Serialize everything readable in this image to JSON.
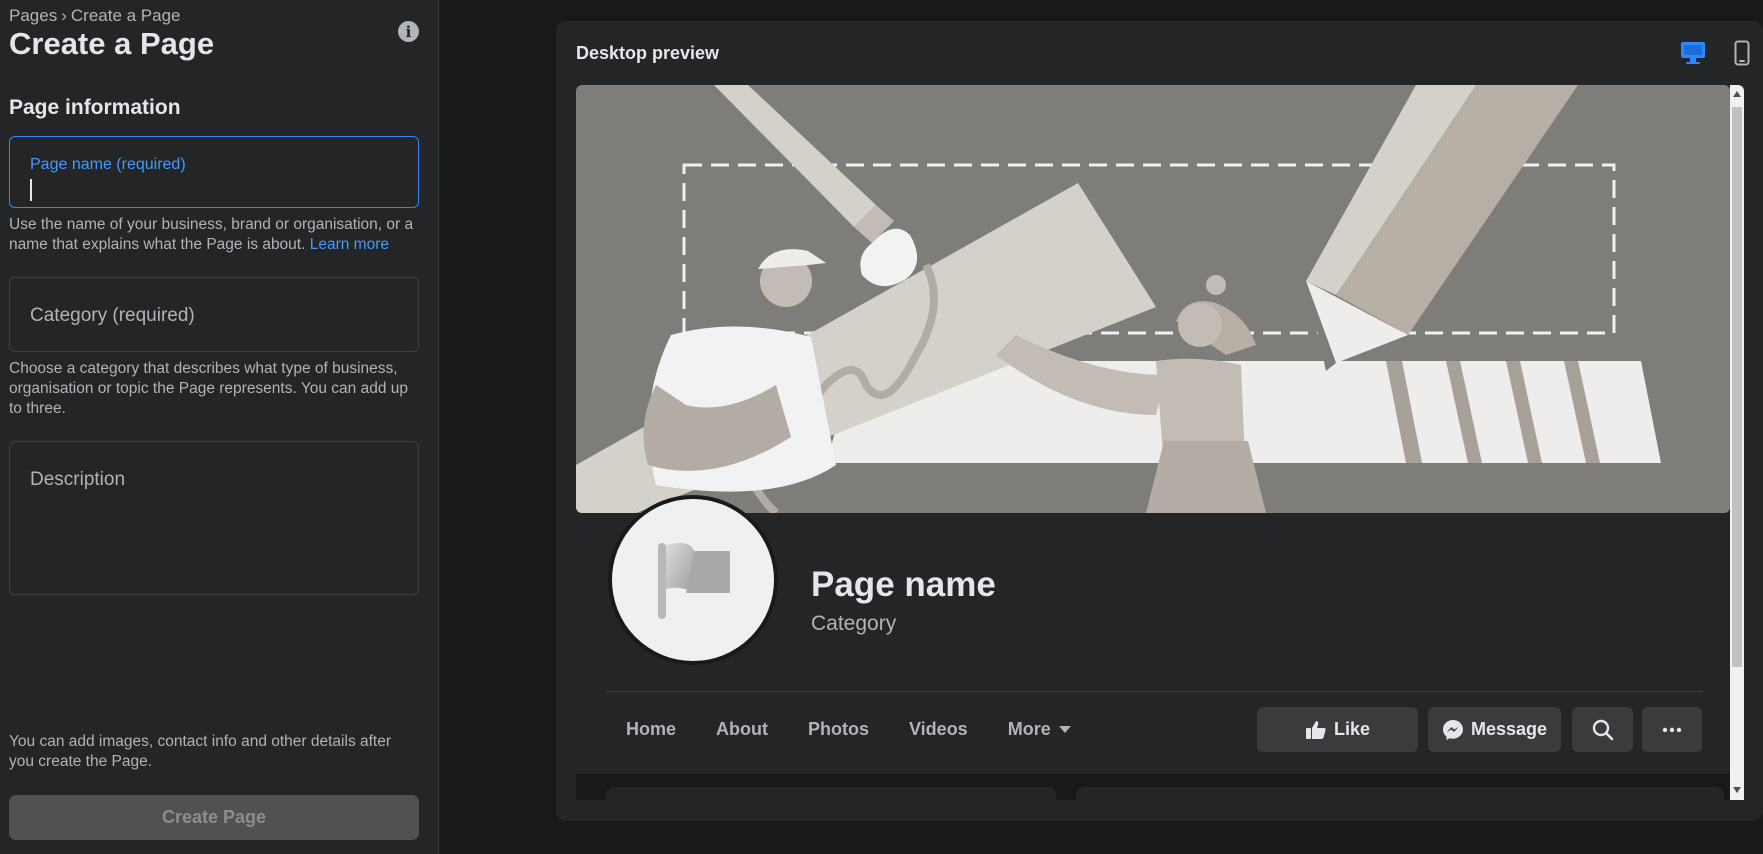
{
  "sidebar": {
    "breadcrumb": {
      "parent": "Pages",
      "separator": "›",
      "current": "Create a Page"
    },
    "title": "Create a Page",
    "section_title": "Page information",
    "page_name_field": {
      "label": "Page name (required)",
      "value": ""
    },
    "page_name_help": "Use the name of your business, brand or organisation, or a name that explains what the Page is about.",
    "learn_more": "Learn more",
    "category_field": {
      "placeholder": "Category (required)"
    },
    "category_help": "Choose a category that describes what type of business, organisation or topic the Page represents. You can add up to three.",
    "description_field": {
      "placeholder": "Description"
    },
    "footer_note": "You can add images, contact info and other details after you create the Page.",
    "create_button": "Create Page",
    "info_icon": "info-icon"
  },
  "preview": {
    "title": "Desktop preview",
    "view_icons": [
      "desktop-icon",
      "mobile-icon"
    ],
    "page_name": "Page name",
    "category": "Category",
    "tabs": [
      "Home",
      "About",
      "Photos",
      "Videos",
      "More"
    ],
    "actions": {
      "like": "Like",
      "message": "Message"
    },
    "colors": {
      "accent": "#2d88ff",
      "cover_bg": "#7f7d7a"
    }
  }
}
